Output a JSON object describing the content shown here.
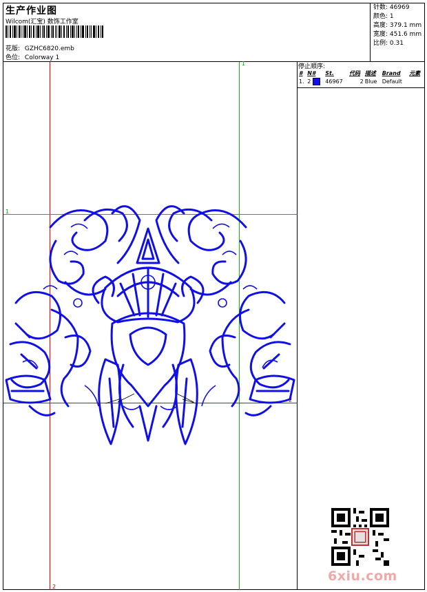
{
  "header": {
    "title": "生产作业图",
    "studio": "Wilcom(汇宝) 数饰工作室",
    "pattern_label": "花版:",
    "pattern_value": "GZHC6820.emb",
    "colorway_label": "色位:",
    "colorway_value": "Colorway 1"
  },
  "stats": [
    {
      "label": "针数:",
      "value": "46969"
    },
    {
      "label": "颜色:",
      "value": "1"
    },
    {
      "label": "高度:",
      "value": "379.1 mm"
    },
    {
      "label": "宽度:",
      "value": "451.6 mm"
    },
    {
      "label": "比例:",
      "value": "0.31"
    }
  ],
  "stop_sequence": {
    "title": "停止顺序:",
    "columns": [
      "#",
      "N#",
      "St.",
      "代码",
      "描述",
      "Brand",
      "元素"
    ],
    "rows": [
      {
        "num": "1.",
        "n": "2",
        "stitches": "46967",
        "code": "2",
        "description": "Blue",
        "brand": "Default",
        "color": "#1010e6"
      }
    ]
  },
  "guides": {
    "top_label": "1",
    "left_label": "1",
    "bottom_label": "2",
    "right_label": "2"
  },
  "colors": {
    "thread": "#1010e6",
    "guide_red": "#e00000",
    "guide_green": "#00c000"
  },
  "watermark": {
    "text": "6xiu.com"
  }
}
